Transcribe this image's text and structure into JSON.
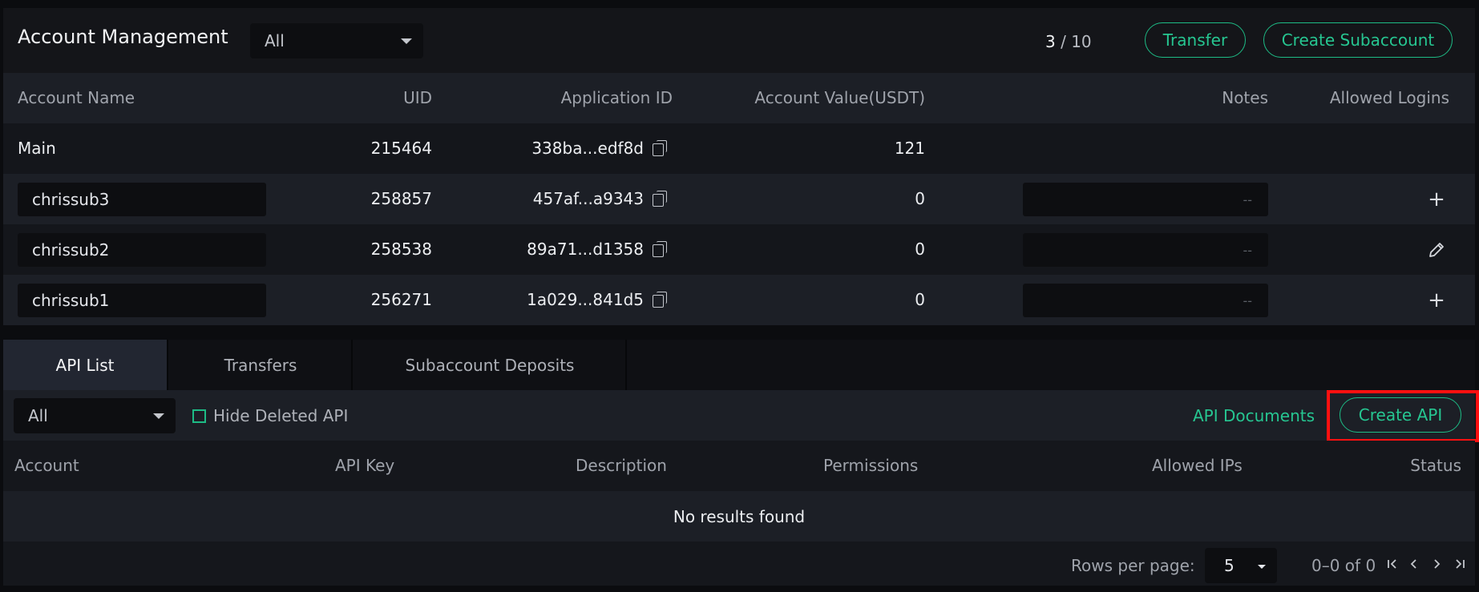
{
  "header": {
    "title": "Account Management",
    "filter_value": "All",
    "count_current": "3",
    "count_sep": "/",
    "count_max": "10",
    "transfer_label": "Transfer",
    "create_subaccount_label": "Create Subaccount"
  },
  "accounts_table": {
    "columns": [
      "Account Name",
      "UID",
      "Application ID",
      "Account Value(USDT)",
      "Notes",
      "Allowed Logins"
    ],
    "rows": [
      {
        "name": "Main",
        "uid": "215464",
        "app_id": "338ba...edf8d",
        "value": "121",
        "notes": "",
        "action": ""
      },
      {
        "name": "chrissub3",
        "uid": "258857",
        "app_id": "457af...a9343",
        "value": "0",
        "notes": "--",
        "action": "plus-icon"
      },
      {
        "name": "chrissub2",
        "uid": "258538",
        "app_id": "89a71...d1358",
        "value": "0",
        "notes": "--",
        "action": "pencil-icon"
      },
      {
        "name": "chrissub1",
        "uid": "256271",
        "app_id": "1a029...841d5",
        "value": "0",
        "notes": "--",
        "action": "plus-icon"
      }
    ]
  },
  "tabs": [
    {
      "label": "API List",
      "active": true
    },
    {
      "label": "Transfers",
      "active": false
    },
    {
      "label": "Subaccount Deposits",
      "active": false
    }
  ],
  "api_toolbar": {
    "filter_value": "All",
    "hide_deleted_label": "Hide Deleted API",
    "hide_deleted_checked": false,
    "docs_link": "API Documents",
    "create_api_label": "Create API"
  },
  "api_table": {
    "columns": [
      "Account",
      "API Key",
      "Description",
      "Permissions",
      "Allowed IPs",
      "Status"
    ],
    "empty_text": "No results found"
  },
  "pagination": {
    "rows_per_page_label": "Rows per page:",
    "rows_per_page_value": "5",
    "range_text": "0–0 of 0"
  },
  "colors": {
    "accent": "#26c691",
    "highlight": "#ff1010",
    "background": "#15171c"
  }
}
